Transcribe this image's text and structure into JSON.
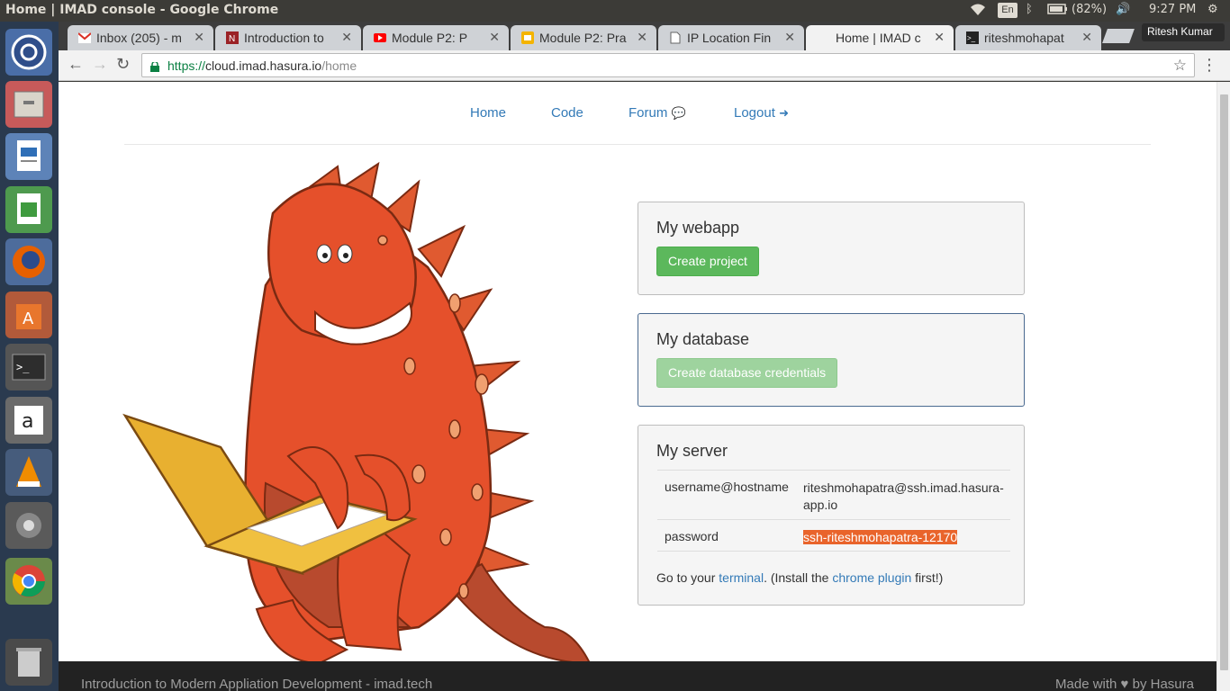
{
  "os": {
    "window_title": "Home | IMAD console - Google Chrome",
    "input_lang": "En",
    "battery": "(82%)",
    "clock": "9:27 PM"
  },
  "browser": {
    "tabs": [
      {
        "label": "Inbox (205) - m",
        "icon": "gmail-icon"
      },
      {
        "label": "Introduction to",
        "icon": "nptel-icon"
      },
      {
        "label": "Module P2: P",
        "icon": "youtube-icon"
      },
      {
        "label": "Module P2: Pra",
        "icon": "slides-icon"
      },
      {
        "label": "IP Location Fin",
        "icon": "page-icon"
      },
      {
        "label": "Home | IMAD c",
        "icon": "none"
      },
      {
        "label": "riteshmohapat",
        "icon": "terminal-icon"
      }
    ],
    "profile": "Ritesh Kumar",
    "url_scheme": "https://",
    "url_host": "cloud.imad.hasura.io",
    "url_path": "/home"
  },
  "nav": {
    "home": "Home",
    "code": "Code",
    "forum": "Forum",
    "logout": "Logout"
  },
  "webapp": {
    "title": "My webapp",
    "button": "Create project"
  },
  "database": {
    "title": "My database",
    "button": "Create database credentials"
  },
  "server": {
    "title": "My server",
    "rows": [
      {
        "key": "username@hostname",
        "value": "riteshmohapatra@ssh.imad.hasura-app.io"
      },
      {
        "key": "password",
        "value": "ssh-riteshmohapatra-12170"
      }
    ],
    "note_prefix": "Go to your ",
    "terminal_link": "terminal",
    "note_mid": ". (Install the ",
    "plugin_link": "chrome plugin",
    "note_suffix": " first!)"
  },
  "footer": {
    "left": "Introduction to Modern Appliation Development - imad.tech",
    "right": "Made with ♥ by Hasura"
  }
}
